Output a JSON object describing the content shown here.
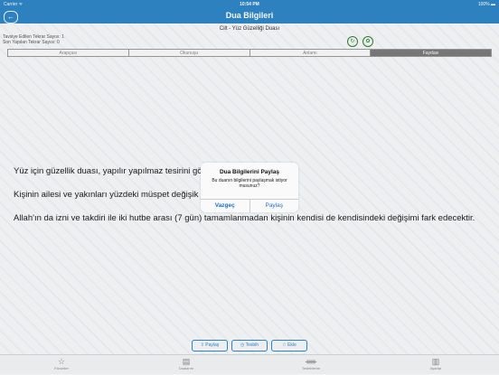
{
  "status_bar": {
    "carrier": "Carrier ᯤ",
    "time": "10:54 PM",
    "battery": "100% ▬"
  },
  "nav": {
    "title": "Dua Bilgileri",
    "back_icon": "back-arrow-icon"
  },
  "prayer": {
    "title": "Cilt - Yüz Güzelliği Duası",
    "recommended_count": "Tavsiye Edilen Tekrar Sayısı: 1",
    "last_count": "Son Yapılan Tekrar Sayısı: 0"
  },
  "tabs": [
    {
      "label": "Arapçası",
      "active": false
    },
    {
      "label": "Okunuşu",
      "active": false
    },
    {
      "label": "Anlamı",
      "active": false
    },
    {
      "label": "Faydası",
      "active": true
    }
  ],
  "body": {
    "line1": "Yüz için güzellik duası, yapılır yapılmaz tesirini gö",
    "line2": "Kişinin ailesi ve yakınları yüzdeki müspet değişik",
    "line3": "Allah'ın da izni ve takdiri ile iki hutbe arası (7 gün) tamamlanmadan kişinin kendisi de kendisindeki değişimi fark edecektir."
  },
  "alert": {
    "title": "Dua Bilgilerini Paylaş",
    "message": "Bu duanın bilgilerini paylaşmak istiyor musunuz?",
    "cancel": "Vazgeç",
    "confirm": "Paylaş"
  },
  "actions": {
    "share": "Paylaş",
    "tesbih": "Tesbih",
    "add": "Ekle"
  },
  "tab_bar": {
    "items": [
      "Favoriler",
      "Dualarım",
      "Tesbihlerim",
      "Ayarlar"
    ]
  },
  "colors": {
    "accent": "#2f86c6",
    "icon_green": "#2e7d32",
    "alert_link": "#1e6fc9"
  }
}
